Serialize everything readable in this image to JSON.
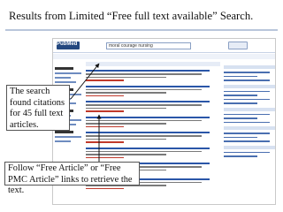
{
  "slide": {
    "title": "Results from Limited “Free full text available” Search."
  },
  "callouts": {
    "found": "The search found citations for 45 full text articles.",
    "follow": "Follow “Free Article” or “Free PMC Article” links to retrieve the text."
  },
  "screenshot": {
    "logo": "PubMed",
    "search_value": "moral courage nursing"
  },
  "colors": {
    "accent": "#2a56a8",
    "rule": "#b9c6db",
    "free_link": "#c0392b"
  }
}
